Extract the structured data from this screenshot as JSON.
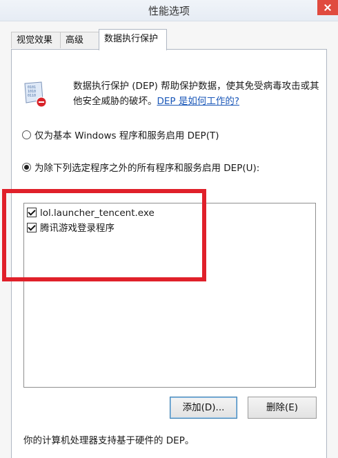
{
  "window": {
    "title": "性能选项"
  },
  "tabs": [
    {
      "label": "视觉效果",
      "active": false
    },
    {
      "label": "高级",
      "active": false
    },
    {
      "label": "数据执行保护",
      "active": true
    }
  ],
  "dep": {
    "icon": "dep-shield-icon",
    "description": "数据执行保护 (DEP) 帮助保护数据，使其免受病毒攻击或其他安全威胁的破坏。",
    "link": "DEP 是如何工作的?",
    "option_basic": "仅为基本 Windows 程序和服务启用 DEP(T)",
    "option_all": "为除下列选定程序之外的所有程序和服务启用 DEP(U):",
    "selected_option": "option_all",
    "exceptions": [
      {
        "name": "lol.launcher_tencent.exe",
        "checked": true
      },
      {
        "name": "腾讯游戏登录程序",
        "checked": true
      }
    ],
    "add_button": "添加(D)...",
    "remove_button": "删除(E)",
    "footer": "你的计算机处理器支持基于硬件的 DEP。"
  },
  "colors": {
    "highlight": "#e0202a",
    "link": "#1a57b8",
    "close": "#e04b3f"
  }
}
